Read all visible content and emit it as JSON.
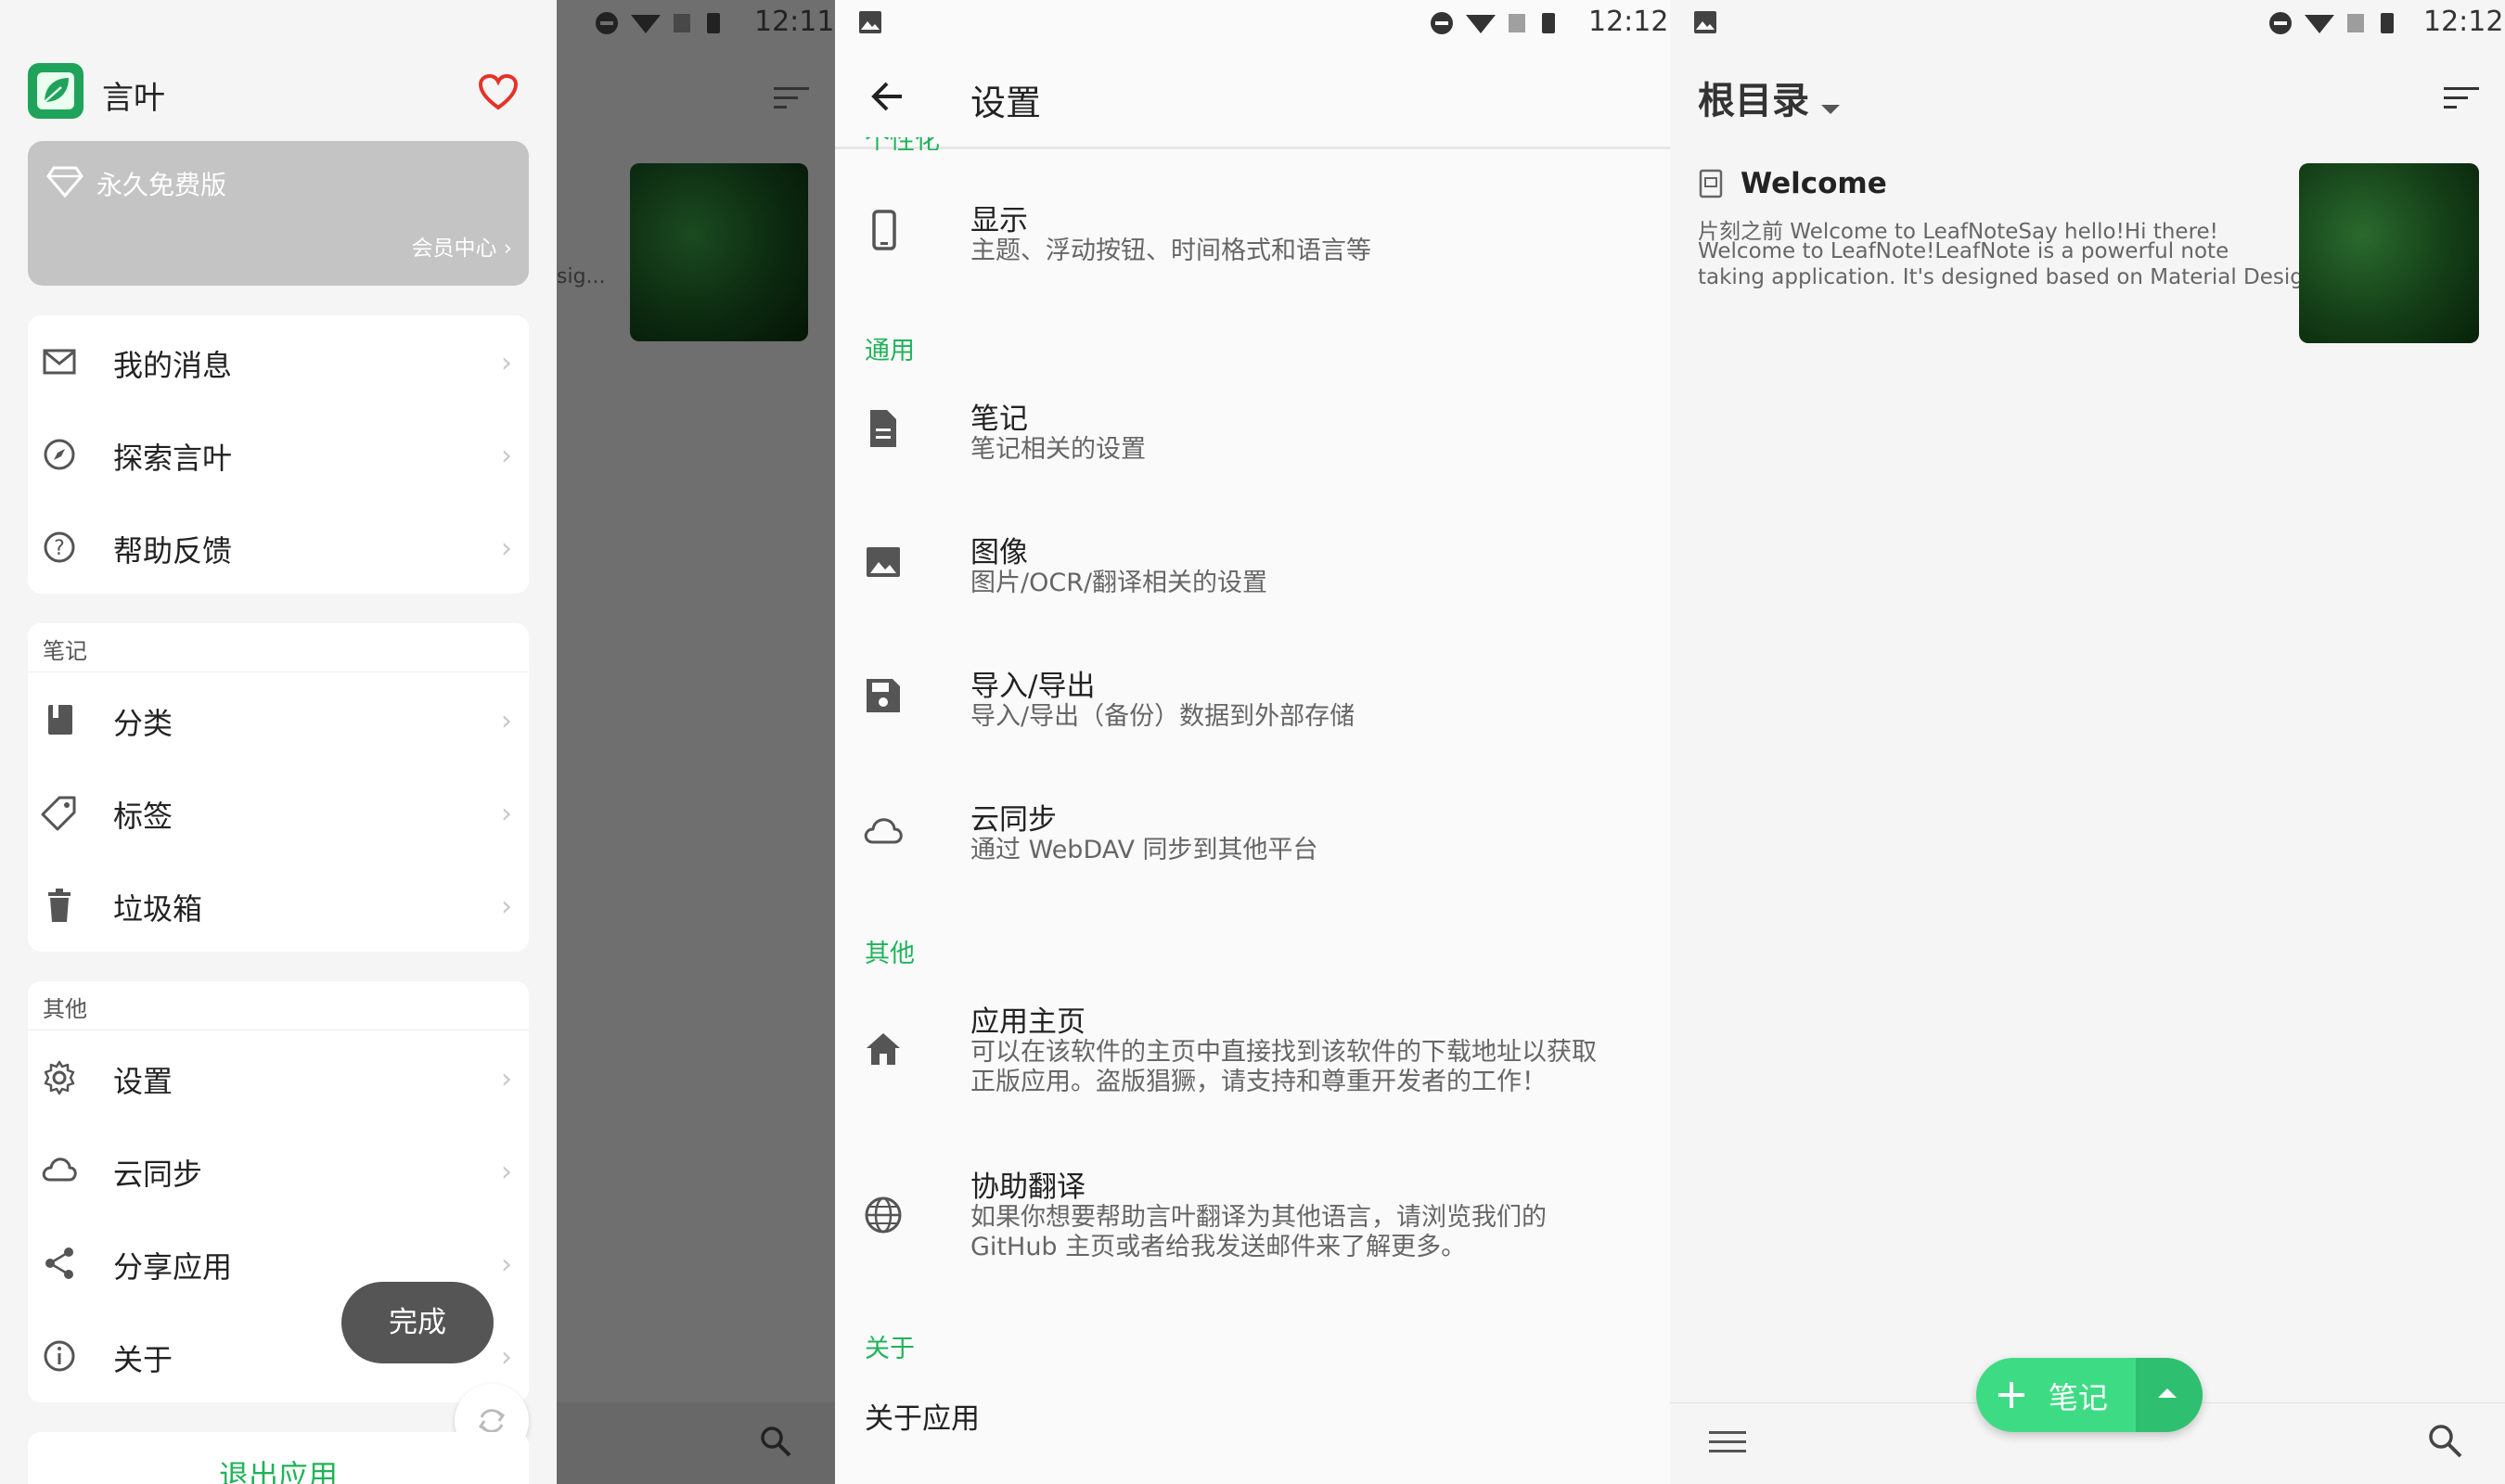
{
  "panel1": {
    "status_time": "12:11",
    "app_name": "言叶",
    "vip": {
      "label": "永久免费版",
      "center_link": "会员中心"
    },
    "menu_top": [
      {
        "label": "我的消息",
        "icon": "mail-icon"
      },
      {
        "label": "探索言叶",
        "icon": "compass-icon"
      },
      {
        "label": "帮助反馈",
        "icon": "help-icon"
      }
    ],
    "notes_section": {
      "title": "笔记",
      "items": [
        {
          "label": "分类",
          "icon": "book-icon"
        },
        {
          "label": "标签",
          "icon": "tag-icon"
        },
        {
          "label": "垃圾箱",
          "icon": "trash-icon"
        }
      ]
    },
    "other_section": {
      "title": "其他",
      "items": [
        {
          "label": "设置",
          "icon": "gear-icon"
        },
        {
          "label": "云同步",
          "icon": "cloud-icon"
        },
        {
          "label": "分享应用",
          "icon": "share-icon"
        },
        {
          "label": "关于",
          "icon": "info-icon"
        }
      ]
    },
    "done_button": "完成",
    "exit_button": "退出应用",
    "behind_snippet": "sig..."
  },
  "panel2": {
    "status_time": "12:12",
    "title": "设置",
    "cut_category": "个性化",
    "items_display": {
      "title": "显示",
      "subtitle": "主题、浮动按钮、时间格式和语言等"
    },
    "cat_general": "通用",
    "items_general": [
      {
        "title": "笔记",
        "subtitle": "笔记相关的设置",
        "icon": "document-icon"
      },
      {
        "title": "图像",
        "subtitle": "图片/OCR/翻译相关的设置",
        "icon": "image-icon"
      },
      {
        "title": "导入/导出",
        "subtitle": "导入/导出（备份）数据到外部存储",
        "icon": "save-icon"
      },
      {
        "title": "云同步",
        "subtitle": "通过 WebDAV 同步到其他平台",
        "icon": "cloud-icon"
      }
    ],
    "cat_other": "其他",
    "items_other": [
      {
        "title": "应用主页",
        "subtitle_1": "可以在该软件的主页中直接找到该软件的下载地址以获取",
        "subtitle_2": "正版应用。盗版猖獗，请支持和尊重开发者的工作！",
        "icon": "home-icon"
      },
      {
        "title": "协助翻译",
        "subtitle_1": "如果你想要帮助言叶翻译为其他语言，请浏览我们的",
        "subtitle_2": "GitHub 主页或者给我发送邮件来了解更多。",
        "icon": "globe-icon"
      }
    ],
    "cat_about": "关于",
    "about_app": "关于应用"
  },
  "panel3": {
    "status_time": "12:12",
    "folder_title": "根目录",
    "note": {
      "title": "Welcome",
      "line1": "片刻之前    Welcome to LeafNoteSay hello!Hi there!",
      "line2": "Welcome to LeafNote!LeafNote is a powerful note",
      "line3": "taking application. It's designed based on Material Desig..."
    },
    "fab_label": "笔记"
  },
  "colors": {
    "accent": "#21b35a",
    "fab": "#3ddc84",
    "heart": "#e5332a",
    "scrim": "#6f6f6f"
  }
}
